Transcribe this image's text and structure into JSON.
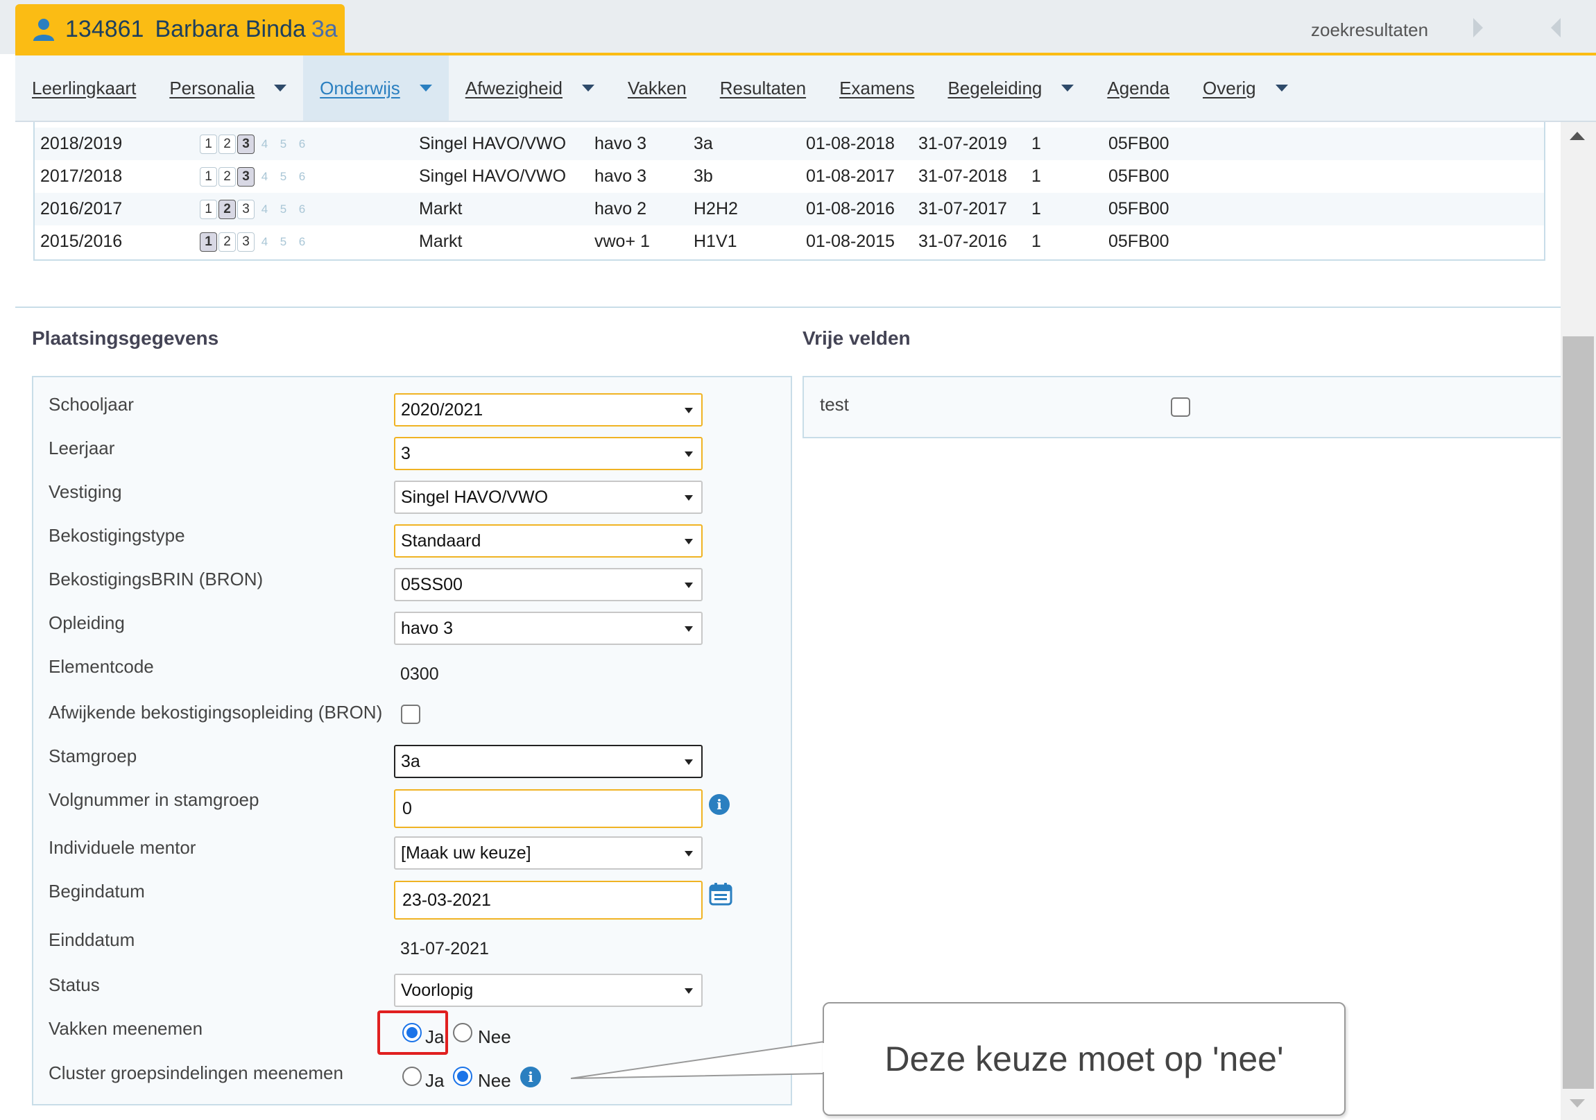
{
  "header": {
    "student_id": "134861",
    "student_name": "Barbara Binda",
    "student_class": "3a",
    "search_results": "zoekresultaten"
  },
  "menu": [
    {
      "label": "Leerlingkaart",
      "dropdown": false,
      "active": false
    },
    {
      "label": "Personalia",
      "dropdown": true,
      "active": false
    },
    {
      "label": "Onderwijs",
      "dropdown": true,
      "active": true
    },
    {
      "label": "Afwezigheid",
      "dropdown": true,
      "active": false
    },
    {
      "label": "Vakken",
      "dropdown": false,
      "active": false
    },
    {
      "label": "Resultaten",
      "dropdown": false,
      "active": false
    },
    {
      "label": "Examens",
      "dropdown": false,
      "active": false
    },
    {
      "label": "Begeleiding",
      "dropdown": true,
      "active": false
    },
    {
      "label": "Agenda",
      "dropdown": false,
      "active": false
    },
    {
      "label": "Overig",
      "dropdown": true,
      "active": false
    }
  ],
  "history": {
    "rows": [
      {
        "year": "2018/2019",
        "level": 3,
        "location": "Singel HAVO/VWO",
        "education": "havo 3",
        "group": "3a",
        "start": "01-08-2018",
        "end": "31-07-2019",
        "num": "1",
        "brin": "05FB00"
      },
      {
        "year": "2017/2018",
        "level": 3,
        "location": "Singel HAVO/VWO",
        "education": "havo 3",
        "group": "3b",
        "start": "01-08-2017",
        "end": "31-07-2018",
        "num": "1",
        "brin": "05FB00"
      },
      {
        "year": "2016/2017",
        "level": 2,
        "location": "Markt",
        "education": "havo 2",
        "group": "H2H2",
        "start": "01-08-2016",
        "end": "31-07-2017",
        "num": "1",
        "brin": "05FB00"
      },
      {
        "year": "2015/2016",
        "level": 1,
        "location": "Markt",
        "education": "vwo+ 1",
        "group": "H1V1",
        "start": "01-08-2015",
        "end": "31-07-2016",
        "num": "1",
        "brin": "05FB00"
      }
    ],
    "level_numbers": [
      "1",
      "2",
      "3",
      "4",
      "5",
      "6"
    ]
  },
  "plaatsing": {
    "title": "Plaatsingsgegevens",
    "schooljaar": {
      "label": "Schooljaar",
      "value": "2020/2021"
    },
    "leerjaar": {
      "label": "Leerjaar",
      "value": "3"
    },
    "vestiging": {
      "label": "Vestiging",
      "value": "Singel HAVO/VWO"
    },
    "bekostigingstype": {
      "label": "Bekostigingstype",
      "value": "Standaard"
    },
    "bekostigingsbrin": {
      "label": "BekostigingsBRIN (BRON)",
      "value": "05SS00"
    },
    "opleiding": {
      "label": "Opleiding",
      "value": "havo 3"
    },
    "elementcode": {
      "label": "Elementcode",
      "value": "0300"
    },
    "afwijkend": {
      "label": "Afwijkende bekostigingsopleiding (BRON)",
      "checked": false
    },
    "stamgroep": {
      "label": "Stamgroep",
      "value": "3a"
    },
    "volgnummer": {
      "label": "Volgnummer in stamgroep",
      "value": "0"
    },
    "mentor": {
      "label": "Individuele mentor",
      "value": "[Maak uw keuze]"
    },
    "begindatum": {
      "label": "Begindatum",
      "value": "23-03-2021"
    },
    "einddatum": {
      "label": "Einddatum",
      "value": "31-07-2021"
    },
    "status": {
      "label": "Status",
      "value": "Voorlopig"
    },
    "vakken_meenemen": {
      "label": "Vakken meenemen",
      "yes": "Ja",
      "no": "Nee",
      "selected": "Ja"
    },
    "cluster_meenemen": {
      "label": "Cluster groepsindelingen meenemen",
      "yes": "Ja",
      "no": "Nee",
      "selected": "Nee"
    }
  },
  "vrije_velden": {
    "title": "Vrije velden",
    "test_label": "test",
    "test_checked": false
  },
  "callout": {
    "text": "Deze keuze moet op 'nee'"
  },
  "colors": {
    "accent_yellow": "#fbbc14",
    "link_blue": "#2a7fc0",
    "highlight_red": "#e02020"
  }
}
